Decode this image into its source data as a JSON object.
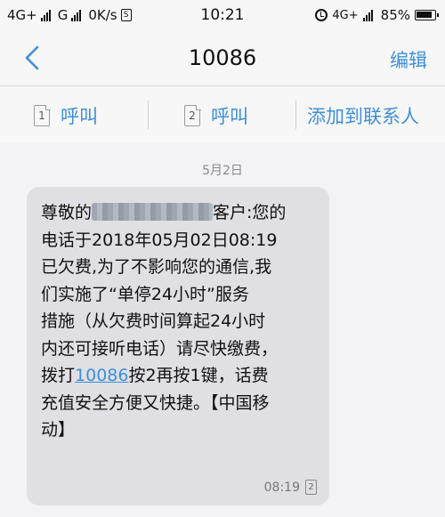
{
  "status_bar": {
    "sim1_network": "4G+",
    "sim2_network": "G",
    "data_speed": "0K/s",
    "sim_badge": "S",
    "time": "10:21",
    "right_network": "4G+",
    "battery": "85%",
    "icons": [
      "signal-icon",
      "alarm-icon",
      "battery-icon"
    ]
  },
  "nav": {
    "title": "10086",
    "edit_label": "编辑"
  },
  "actions": {
    "call1": {
      "sim": "1",
      "label": "呼叫"
    },
    "call2": {
      "sim": "2",
      "label": "呼叫"
    },
    "add_contact": "添加到联系人"
  },
  "conversation": {
    "date": "5月2日",
    "message": {
      "lines": [
        {
          "prefix": "尊敬的",
          "suffix": "客户:您的"
        },
        "电话于2018年05月02日08:19",
        "已欠费,为了不影响您的通信,我",
        "们实施了“单停24小时”服务",
        "措施（从欠费时间算起24小时",
        "内还可接听电话）请尽快缴费，",
        {
          "prefix": "拨打",
          "link": "10086",
          "suffix": "按2再按1键，话费"
        },
        "充值安全方便又快捷。【中国移",
        "动】"
      ],
      "time": "08:19",
      "sim": "2"
    }
  },
  "colors": {
    "accent": "#3d8fd8",
    "bubble": "#e0e0e4",
    "background": "#f3f3f5"
  }
}
